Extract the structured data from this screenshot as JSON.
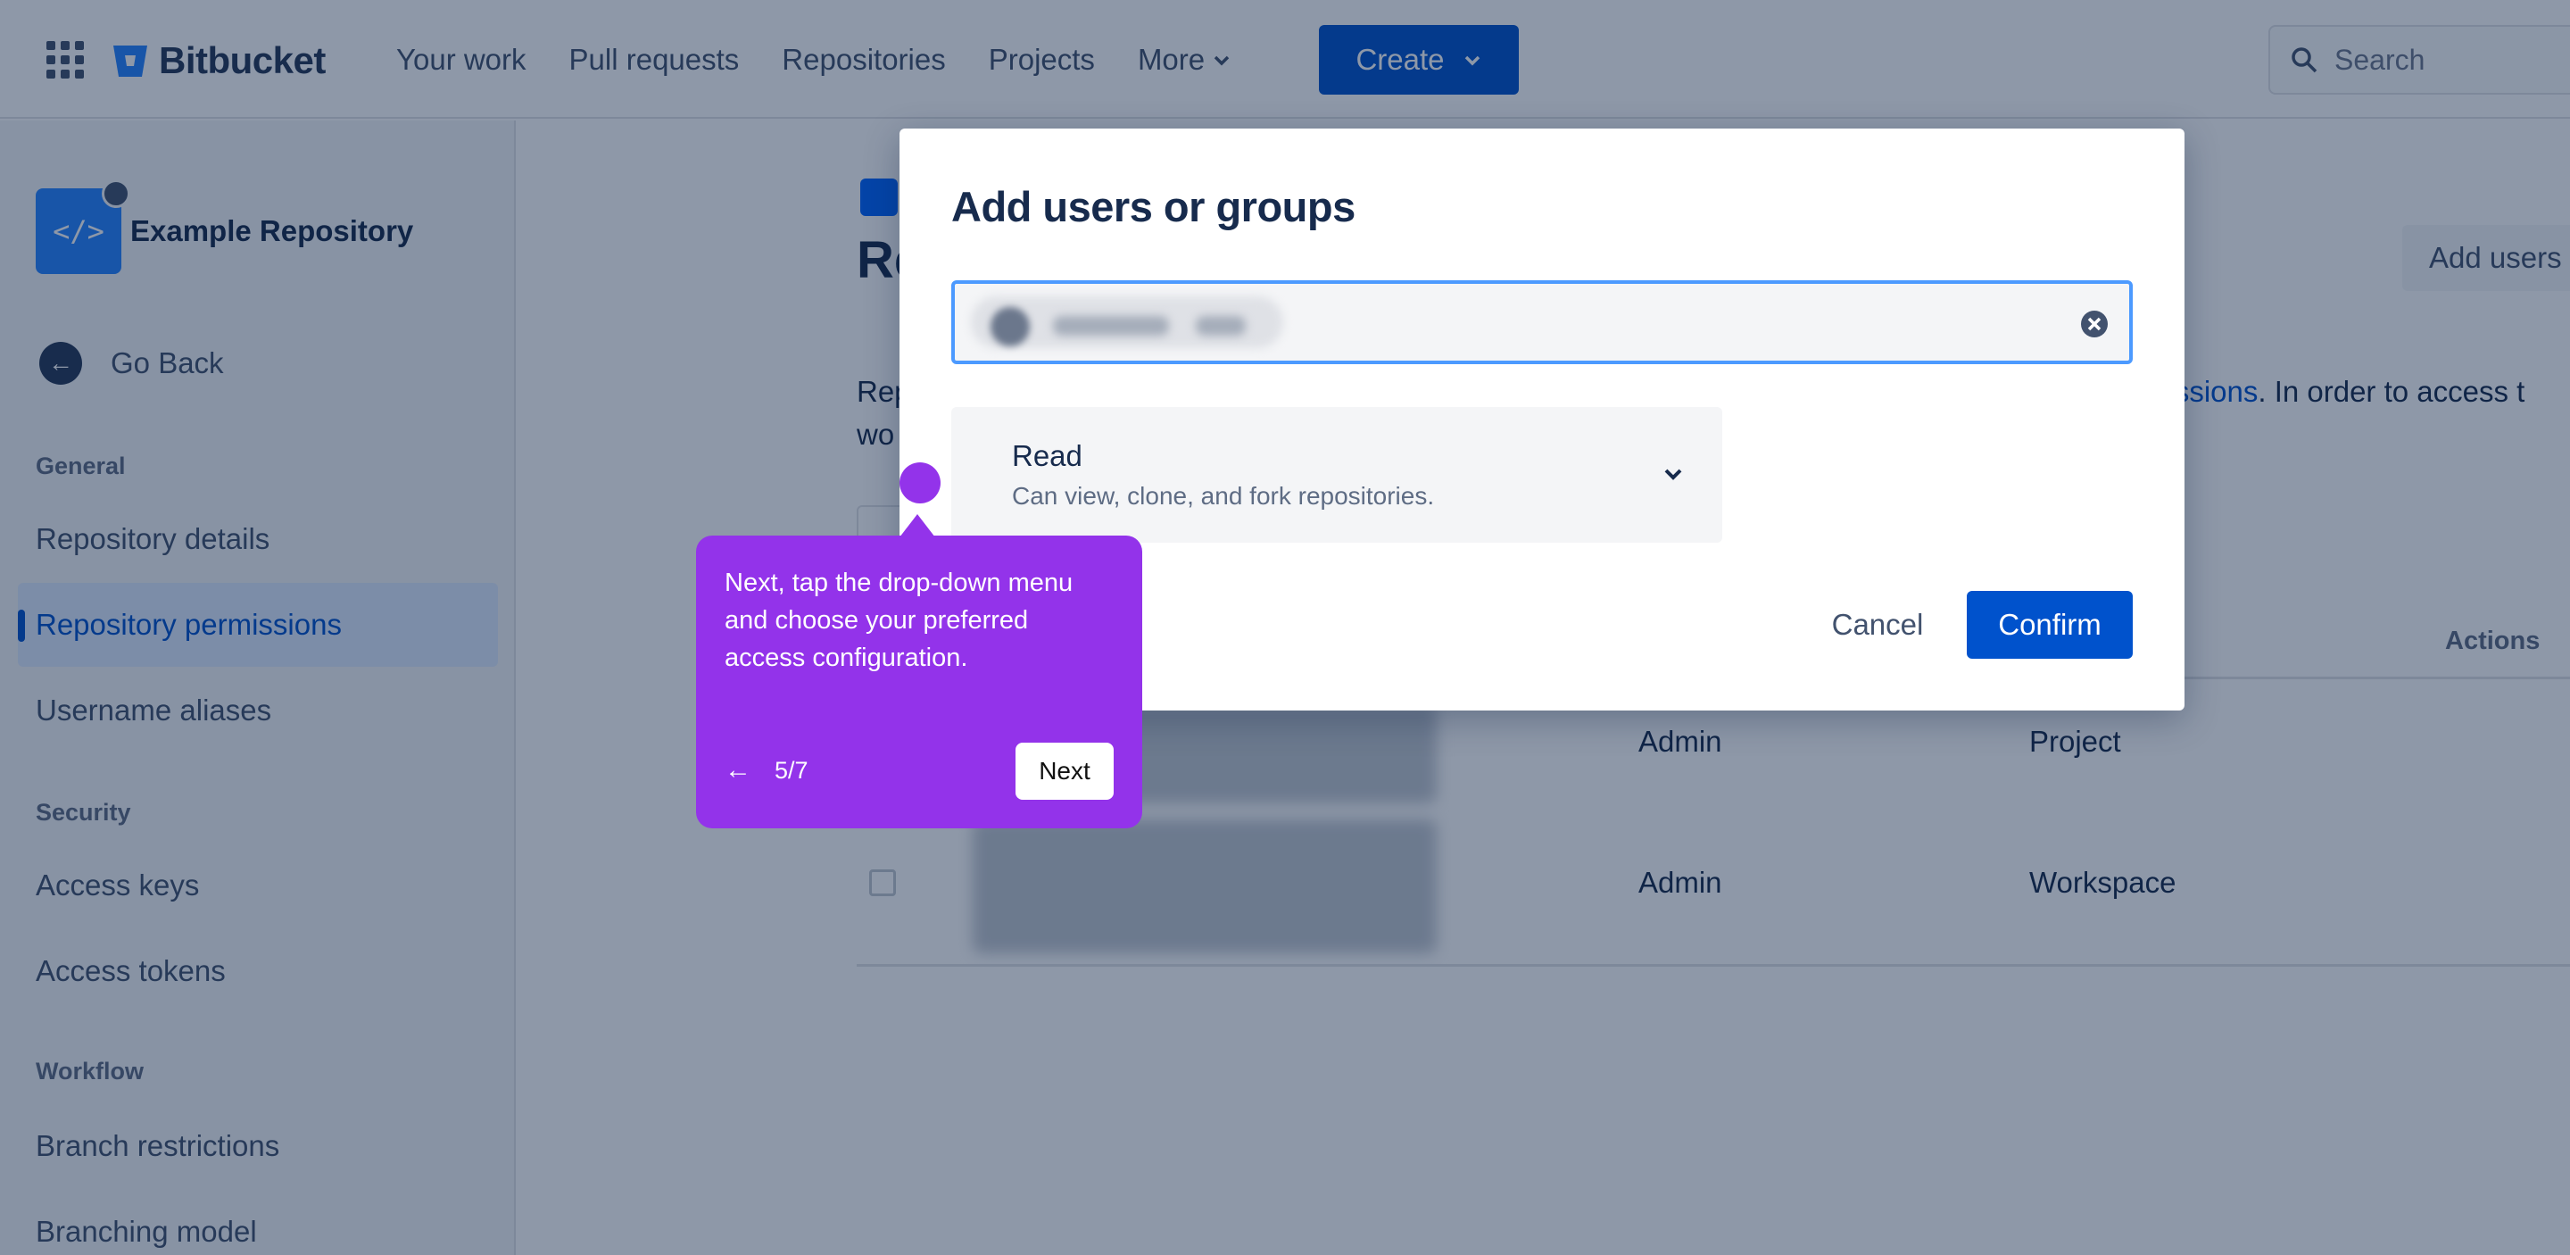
{
  "topbar": {
    "app_name": "Bitbucket",
    "nav": [
      "Your work",
      "Pull requests",
      "Repositories",
      "Projects"
    ],
    "more_label": "More",
    "create_label": "Create",
    "search_placeholder": "Search"
  },
  "sidebar": {
    "repo_name": "Example Repository",
    "go_back": "Go Back",
    "sections": [
      {
        "heading": "General",
        "items": [
          "Repository details",
          "Repository permissions",
          "Username aliases"
        ]
      },
      {
        "heading": "Security",
        "items": [
          "Access keys",
          "Access tokens"
        ]
      },
      {
        "heading": "Workflow",
        "items": [
          "Branch restrictions",
          "Branching model"
        ]
      }
    ],
    "active_item": "Repository permissions"
  },
  "main": {
    "title_partial": "Re",
    "add_users_label": "Add users",
    "desc_start_1": "Rep",
    "desc_start_2": "wo",
    "desc_link": "missions",
    "desc_end": ". In order to access t",
    "actions_header": "Actions",
    "rows": [
      {
        "permission": "Admin",
        "source": "Project"
      },
      {
        "permission": "Admin",
        "source": "Workspace"
      }
    ]
  },
  "modal": {
    "title": "Add users or groups",
    "permission_name": "Read",
    "permission_desc": "Can view, clone, and fork repositories.",
    "cancel_label": "Cancel",
    "confirm_label": "Confirm"
  },
  "guide": {
    "text": "Next, tap the drop-down menu and choose your preferred access configuration.",
    "step": "5/7",
    "back_symbol": "←",
    "next_label": "Next",
    "color": "#9333ea"
  }
}
